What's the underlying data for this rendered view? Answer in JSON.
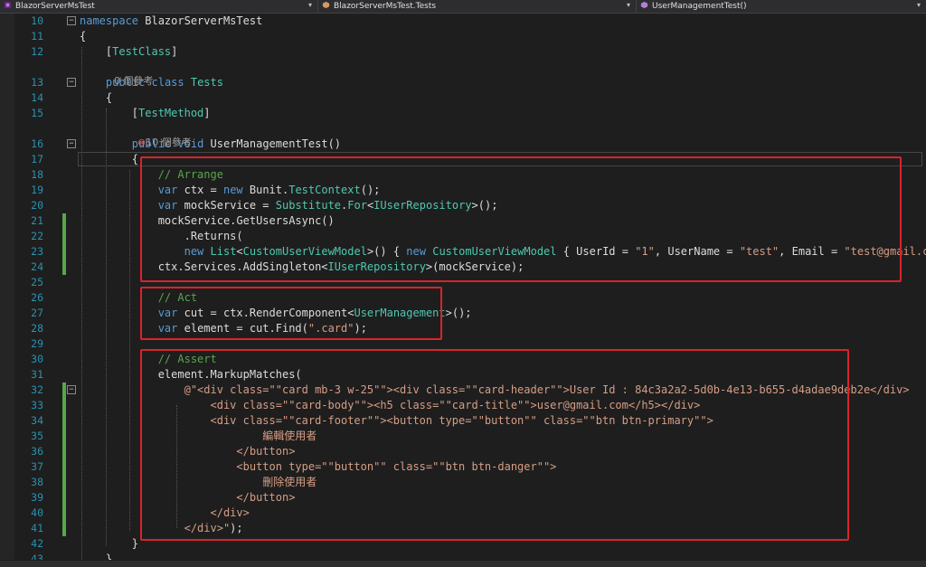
{
  "navbar": {
    "project": "BlazorServerMsTest",
    "type": "BlazorServerMsTest.Tests",
    "member": "UserManagementTest()"
  },
  "editor": {
    "lines": [
      {
        "n": "10",
        "segs": [
          [
            "kw",
            "namespace"
          ],
          [
            "p",
            " BlazorServerMsTest"
          ]
        ]
      },
      {
        "n": "11",
        "segs": [
          [
            "p",
            "{"
          ]
        ]
      },
      {
        "n": "12",
        "segs": [
          [
            "p",
            "    ["
          ],
          [
            "ty",
            "TestClass"
          ],
          [
            "p",
            "]"
          ]
        ]
      },
      {
        "n": "13",
        "segs": [
          [
            "p",
            "    "
          ],
          [
            "kw",
            "public"
          ],
          [
            "p",
            " "
          ],
          [
            "kw",
            "class"
          ],
          [
            "p",
            " "
          ],
          [
            "ty",
            "Tests"
          ]
        ]
      },
      {
        "n": "14",
        "segs": [
          [
            "p",
            "    {"
          ]
        ]
      },
      {
        "n": "15",
        "segs": [
          [
            "p",
            "        ["
          ],
          [
            "ty",
            "TestMethod"
          ],
          [
            "p",
            "]"
          ]
        ]
      },
      {
        "n": "16",
        "segs": [
          [
            "p",
            "        "
          ],
          [
            "kw",
            "public"
          ],
          [
            "p",
            " "
          ],
          [
            "kw",
            "void"
          ],
          [
            "p",
            " UserManagementTest()"
          ]
        ]
      },
      {
        "n": "17",
        "segs": [
          [
            "p",
            "        {"
          ]
        ]
      },
      {
        "n": "18",
        "segs": [
          [
            "cm",
            "            // Arrange"
          ]
        ]
      },
      {
        "n": "19",
        "segs": [
          [
            "p",
            "            "
          ],
          [
            "kw",
            "var"
          ],
          [
            "p",
            " ctx = "
          ],
          [
            "kw",
            "new"
          ],
          [
            "p",
            " Bunit."
          ],
          [
            "ty",
            "TestContext"
          ],
          [
            "p",
            "();"
          ]
        ]
      },
      {
        "n": "20",
        "segs": [
          [
            "p",
            "            "
          ],
          [
            "kw",
            "var"
          ],
          [
            "p",
            " mockService = "
          ],
          [
            "ty",
            "Substitute"
          ],
          [
            "p",
            "."
          ],
          [
            "ty",
            "For"
          ],
          [
            "p",
            "<"
          ],
          [
            "ty",
            "IUserRepository"
          ],
          [
            "p",
            ">();"
          ]
        ]
      },
      {
        "n": "21",
        "segs": [
          [
            "p",
            "            mockService.GetUsersAsync()"
          ]
        ]
      },
      {
        "n": "22",
        "segs": [
          [
            "p",
            "                .Returns("
          ]
        ]
      },
      {
        "n": "23",
        "segs": [
          [
            "p",
            "                "
          ],
          [
            "kw",
            "new"
          ],
          [
            "p",
            " "
          ],
          [
            "ty",
            "List"
          ],
          [
            "p",
            "<"
          ],
          [
            "ty",
            "CustomUserViewModel"
          ],
          [
            "p",
            ">() { "
          ],
          [
            "kw",
            "new"
          ],
          [
            "p",
            " "
          ],
          [
            "ty",
            "CustomUserViewModel"
          ],
          [
            "p",
            " { UserId = "
          ],
          [
            "st",
            "\"1\""
          ],
          [
            "p",
            ", UserName = "
          ],
          [
            "st",
            "\"test\""
          ],
          [
            "p",
            ", Email = "
          ],
          [
            "st",
            "\"test@gmail.com\""
          ],
          [
            "p",
            " } });"
          ]
        ]
      },
      {
        "n": "24",
        "segs": [
          [
            "p",
            "            ctx.Services.AddSingleton<"
          ],
          [
            "ty",
            "IUserRepository"
          ],
          [
            "p",
            ">(mockService);"
          ]
        ]
      },
      {
        "n": "25",
        "segs": [
          [
            "p",
            ""
          ]
        ]
      },
      {
        "n": "26",
        "segs": [
          [
            "cm",
            "            // Act"
          ]
        ]
      },
      {
        "n": "27",
        "segs": [
          [
            "p",
            "            "
          ],
          [
            "kw",
            "var"
          ],
          [
            "p",
            " cut = ctx.RenderComponent<"
          ],
          [
            "ty",
            "UserManagement"
          ],
          [
            "p",
            ">();"
          ]
        ]
      },
      {
        "n": "28",
        "segs": [
          [
            "p",
            "            "
          ],
          [
            "kw",
            "var"
          ],
          [
            "p",
            " element = cut.Find("
          ],
          [
            "st",
            "\".card\""
          ],
          [
            "p",
            ");"
          ]
        ]
      },
      {
        "n": "29",
        "segs": [
          [
            "p",
            ""
          ]
        ]
      },
      {
        "n": "30",
        "segs": [
          [
            "cm",
            "            // Assert"
          ]
        ]
      },
      {
        "n": "31",
        "segs": [
          [
            "p",
            "            element.MarkupMatches("
          ]
        ]
      },
      {
        "n": "32",
        "segs": [
          [
            "p",
            "                "
          ],
          [
            "st",
            "@\"<div class=\"\"card mb-3 w-25\"\"><div class=\"\"card-header\"\">User Id : 84c3a2a2-5d0b-4e13-b655-d4adae9deb2e</div>"
          ]
        ]
      },
      {
        "n": "33",
        "segs": [
          [
            "st",
            "                    <div class=\"\"card-body\"\"><h5 class=\"\"card-title\"\">user@gmail.com</h5></div>"
          ]
        ]
      },
      {
        "n": "34",
        "segs": [
          [
            "st",
            "                    <div class=\"\"card-footer\"\"><button type=\"\"button\"\" class=\"\"btn btn-primary\"\">"
          ]
        ]
      },
      {
        "n": "35",
        "segs": [
          [
            "st",
            "                            編輯使用者"
          ]
        ]
      },
      {
        "n": "36",
        "segs": [
          [
            "st",
            "                        </button>"
          ]
        ]
      },
      {
        "n": "37",
        "segs": [
          [
            "st",
            "                        <button type=\"\"button\"\" class=\"\"btn btn-danger\"\">"
          ]
        ]
      },
      {
        "n": "38",
        "segs": [
          [
            "st",
            "                            刪除使用者"
          ]
        ]
      },
      {
        "n": "39",
        "segs": [
          [
            "st",
            "                        </button>"
          ]
        ]
      },
      {
        "n": "40",
        "segs": [
          [
            "st",
            "                    </div>"
          ]
        ]
      },
      {
        "n": "41",
        "segs": [
          [
            "st",
            "                </div>\""
          ],
          [
            "p",
            ");"
          ]
        ]
      },
      {
        "n": "42",
        "segs": [
          [
            "p",
            "        }"
          ]
        ]
      },
      {
        "n": "43",
        "segs": [
          [
            "p",
            "    }"
          ]
        ]
      }
    ],
    "hints": {
      "class_refs": "0 個參考",
      "method_refs": "10 個參考"
    }
  },
  "colors": {
    "keyword": "#569cd6",
    "type": "#4ec9b0",
    "comment": "#57a64a",
    "string": "#d69d85",
    "highlight_box": "#d8242b"
  }
}
